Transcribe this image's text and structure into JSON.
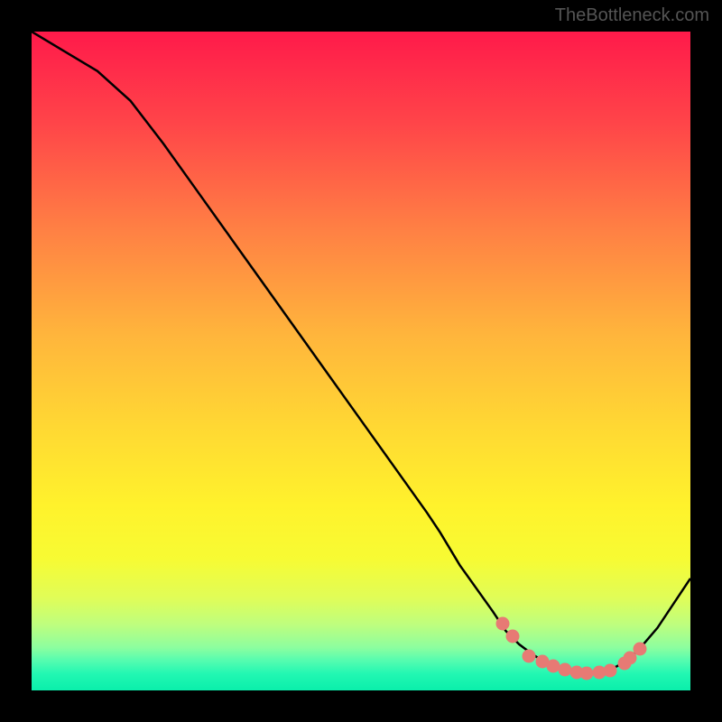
{
  "watermark": "TheBottleneck.com",
  "chart_data": {
    "type": "line",
    "title": "",
    "xlabel": "",
    "ylabel": "",
    "xlim": [
      0,
      100
    ],
    "ylim": [
      0,
      100
    ],
    "curve": {
      "x": [
        0,
        5,
        10,
        15,
        20,
        25,
        30,
        35,
        40,
        45,
        50,
        55,
        60,
        62,
        65,
        70,
        72,
        74,
        76,
        78,
        80,
        82,
        84,
        86,
        88,
        90,
        92,
        95,
        100
      ],
      "y": [
        100,
        97,
        94,
        89.5,
        83,
        76,
        69,
        62,
        55,
        48,
        41,
        34,
        27,
        24,
        19,
        12,
        9,
        7,
        5.5,
        4.2,
        3.3,
        2.8,
        2.6,
        2.7,
        3.2,
        4.3,
        6,
        9.5,
        17
      ]
    },
    "markers": {
      "x": [
        71.5,
        73,
        75.5,
        77.5,
        79.2,
        81,
        82.7,
        84.3,
        86.2,
        87.8,
        90,
        90.8,
        92.3
      ],
      "y": [
        10.2,
        8.2,
        5.2,
        4.4,
        3.7,
        3.2,
        2.8,
        2.6,
        2.7,
        3,
        4.1,
        5,
        6.3
      ]
    },
    "gradient_stops": [
      {
        "offset": 0.0,
        "color": "#FF1A4A"
      },
      {
        "offset": 0.14,
        "color": "#FF4549"
      },
      {
        "offset": 0.3,
        "color": "#FF8044"
      },
      {
        "offset": 0.46,
        "color": "#FFB53C"
      },
      {
        "offset": 0.6,
        "color": "#FFD833"
      },
      {
        "offset": 0.72,
        "color": "#FFF22C"
      },
      {
        "offset": 0.8,
        "color": "#F7FB33"
      },
      {
        "offset": 0.86,
        "color": "#E0FD58"
      },
      {
        "offset": 0.9,
        "color": "#BEFE7E"
      },
      {
        "offset": 0.935,
        "color": "#8CFE9F"
      },
      {
        "offset": 0.955,
        "color": "#54FCB0"
      },
      {
        "offset": 0.975,
        "color": "#22F7B2"
      },
      {
        "offset": 1.0,
        "color": "#0AEFAB"
      }
    ]
  }
}
